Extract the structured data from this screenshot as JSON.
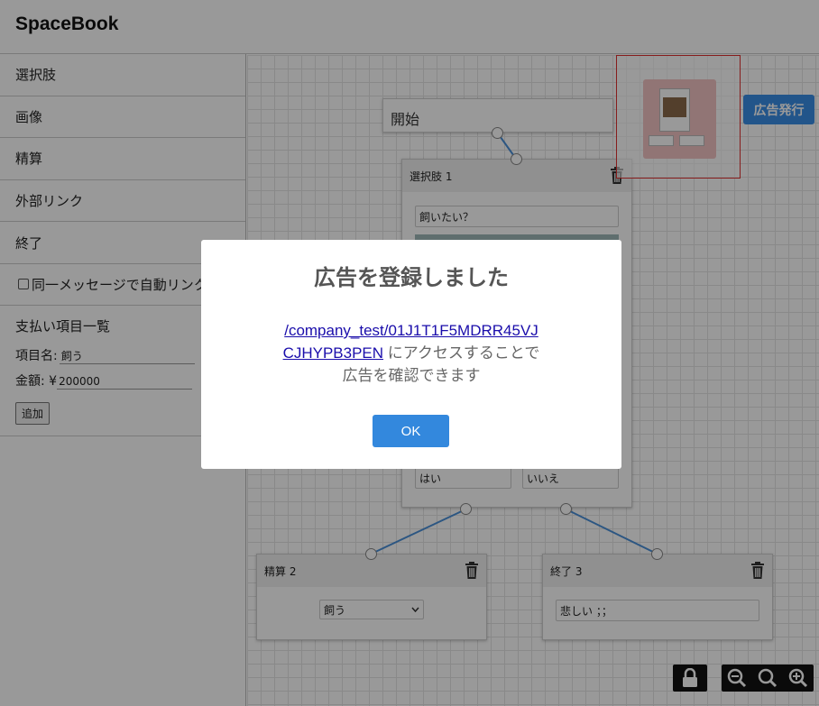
{
  "app": {
    "title": "SpaceBook"
  },
  "sidebar": {
    "items": [
      {
        "label": "選択肢"
      },
      {
        "label": "画像"
      },
      {
        "label": "精算"
      },
      {
        "label": "外部リンク"
      },
      {
        "label": "終了"
      }
    ],
    "auto_link_label": "同一メッセージで自動リンク",
    "payments": {
      "title": "支払い項目一覧",
      "item_name_label": "項目名:",
      "item_name_value": "飼う",
      "amount_label": "金額: ¥",
      "amount_value": "200000",
      "add_button": "追加"
    }
  },
  "canvas": {
    "start_label": "開始",
    "choice_node": {
      "title": "選択肢 1",
      "question": "飼いたい？",
      "option_yes": "はい",
      "option_no": "いいえ"
    },
    "settle_node": {
      "title": "精算 2",
      "select_value": "飼う"
    },
    "end_node": {
      "title": "終了 3",
      "message": "悲しい ；；"
    },
    "ad_button": "広告発行"
  },
  "modal": {
    "title": "広告を登録しました",
    "link_text_1": "/company_test/01J1T1F5MDRR45VJ",
    "link_text_2": "CJHYPB3PEN",
    "message_1": " にアクセスすることで",
    "message_2": "広告を確認できます",
    "ok_button": "OK"
  },
  "colors": {
    "accent": "#3388dd",
    "link": "#1a0dab",
    "connector": "#4a90d9",
    "highlight": "#e03030"
  }
}
